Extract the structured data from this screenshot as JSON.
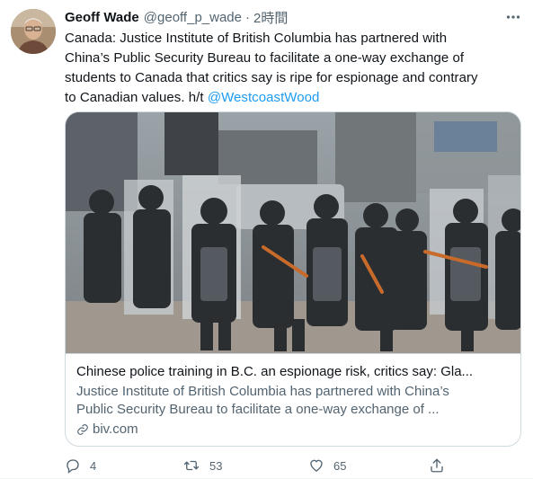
{
  "tweet": {
    "author_name": "Geoff Wade",
    "handle": "@geoff_p_wade",
    "separator": "·",
    "time": "2時間",
    "text_lines": [
      "Canada: Justice Institute of British Columbia has partnered with",
      "China’s Public Security Bureau to facilitate a one-way exchange of",
      "students to Canada that critics say is ripe for espionage and contrary",
      "to Canadian values. h/t "
    ],
    "mention": "@WestcoastWood"
  },
  "card": {
    "title": "Chinese police training in B.C. an espionage risk, critics say: Gla...",
    "desc_lines": [
      "Justice Institute of British Columbia has partnered with China’s",
      "Public Security Bureau to facilitate a one-way exchange of ..."
    ],
    "domain": "biv.com"
  },
  "actions": {
    "replies": "4",
    "retweets": "53",
    "likes": "65"
  },
  "icons": {
    "reply": "reply-icon",
    "retweet": "retweet-icon",
    "like": "heart-icon",
    "share": "share-icon",
    "more": "more-icon",
    "link": "link-icon"
  },
  "colors": {
    "accent": "#1d9bf0",
    "text": "#0f1419",
    "secondary": "#536471",
    "border": "#cfd9de"
  }
}
